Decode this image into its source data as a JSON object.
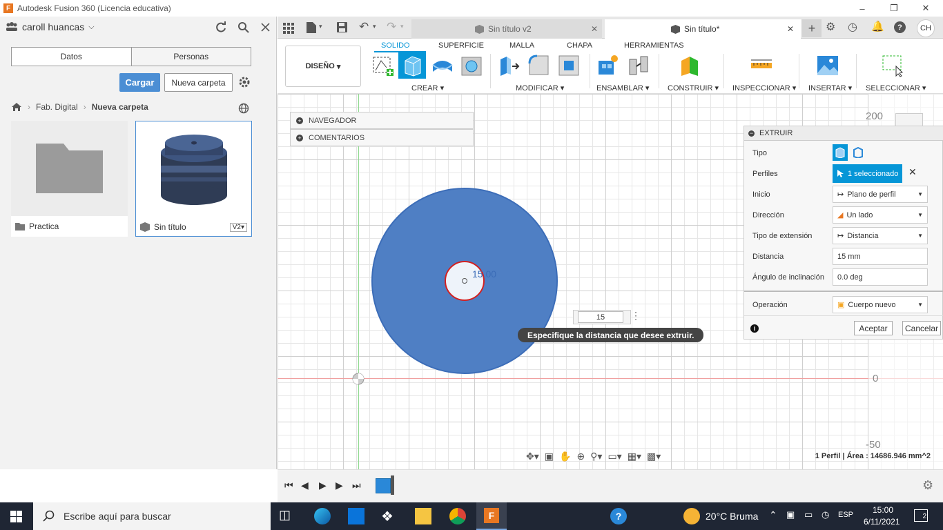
{
  "window": {
    "title": "Autodesk Fusion 360 (Licencia educativa)",
    "app_logo": "F"
  },
  "data_panel": {
    "user": "caroll huancas",
    "tabs": [
      "Datos",
      "Personas"
    ],
    "upload_label": "Cargar",
    "new_folder_label": "Nueva carpeta",
    "breadcrumb": [
      "Fab. Digital",
      "Nueva carpeta"
    ],
    "items": [
      {
        "name": "Practica",
        "type": "folder"
      },
      {
        "name": "Sin título",
        "type": "design",
        "version": "V2"
      }
    ]
  },
  "doc_tabs": [
    {
      "label": "Sin título v2",
      "active": false
    },
    {
      "label": "Sin título*",
      "active": true
    }
  ],
  "header": {
    "user_initials": "CH"
  },
  "workspace": {
    "label": "DISEÑO"
  },
  "ribbon": {
    "tabs": [
      "SOLIDO",
      "SUPERFICIE",
      "MALLA",
      "CHAPA",
      "HERRAMIENTAS"
    ],
    "active_tab": "SOLIDO",
    "groups": [
      "CREAR",
      "MODIFICAR",
      "ENSAMBLAR",
      "CONSTRUIR",
      "INSPECCIONAR",
      "INSERTAR",
      "SELECCIONAR"
    ]
  },
  "browser": {
    "navigator": "NAVEGADOR",
    "comments": "COMENTARIOS"
  },
  "viewport": {
    "dimension_label": "15.00",
    "distance_input": "15",
    "tooltip": "Especifique la distancia que desee extruir.",
    "ruler_labels": [
      "200",
      "0",
      "-50"
    ],
    "status": "1 Perfil | Área : 14686.946 mm^2"
  },
  "extrude_dialog": {
    "title": "EXTRUIR",
    "rows": [
      {
        "label": "Tipo"
      },
      {
        "label": "Perfiles",
        "value": "1 seleccionado"
      },
      {
        "label": "Inicio",
        "value": "Plano de perfil"
      },
      {
        "label": "Dirección",
        "value": "Un lado"
      },
      {
        "label": "Tipo de extensión",
        "value": "Distancia"
      },
      {
        "label": "Distancia",
        "value": "15 mm"
      },
      {
        "label": "Ángulo de inclinación",
        "value": "0.0 deg"
      },
      {
        "label": "Operación",
        "value": "Cuerpo nuevo"
      }
    ],
    "ok_label": "Aceptar",
    "cancel_label": "Cancelar"
  },
  "taskbar": {
    "search_placeholder": "Escribe aquí para buscar",
    "weather": "20°C  Bruma",
    "lang": "ESP",
    "time": "15:00",
    "date": "6/11/2021",
    "notifications": "2"
  },
  "colors": {
    "accent": "#0696d7",
    "profile": "#4f7fc4",
    "extrude_blue": "#1a8ed8"
  }
}
